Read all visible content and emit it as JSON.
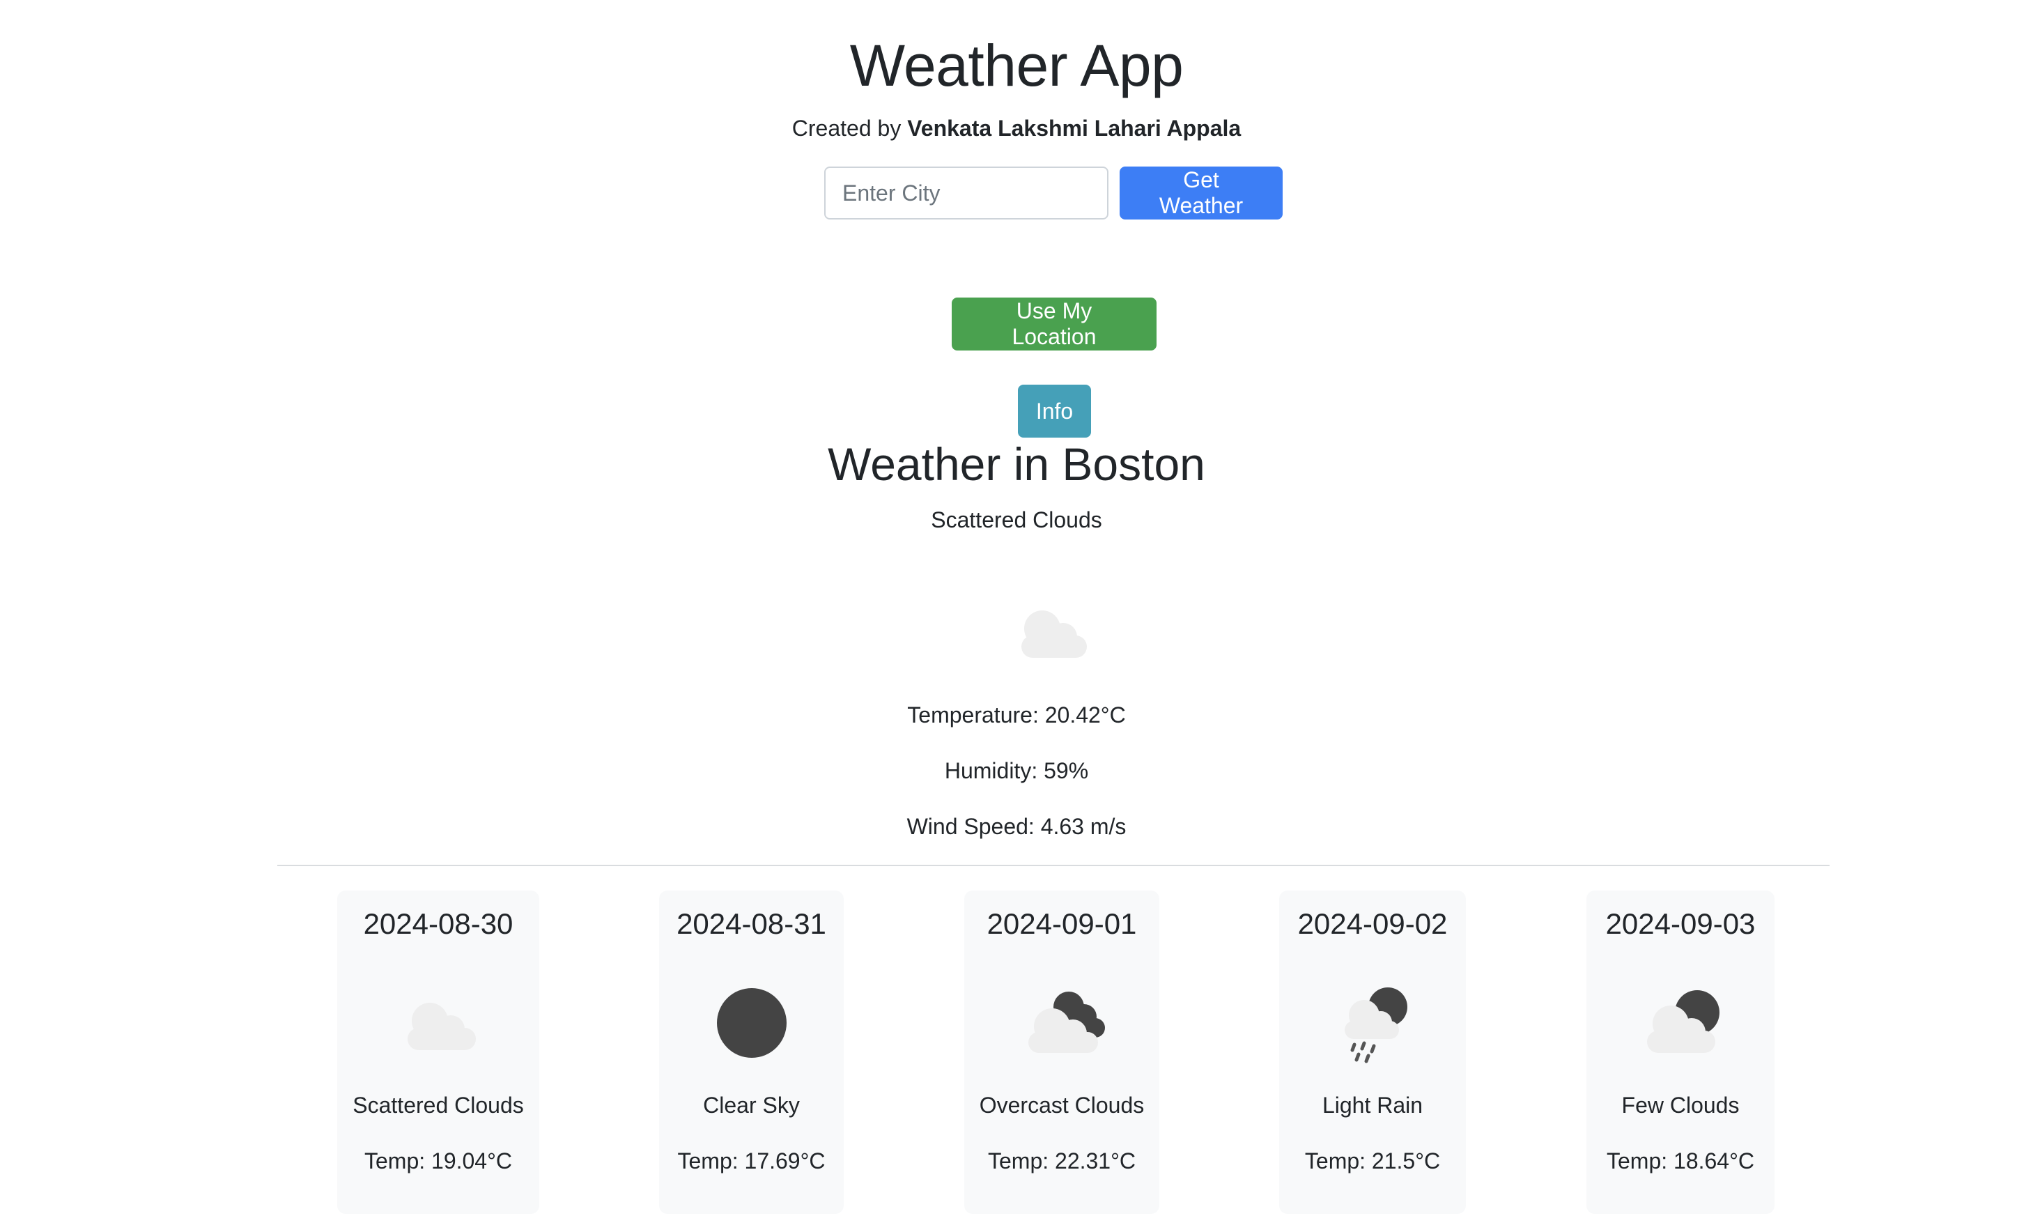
{
  "header": {
    "title": "Weather App",
    "credit_prefix": "Created by",
    "credit_name": "Venkata Lakshmi Lahari Appala"
  },
  "search": {
    "placeholder": "Enter City",
    "value": "",
    "button_label": "Get Weather"
  },
  "location_button_label": "Use My Location",
  "info_button_label": "Info",
  "current": {
    "title": "Weather in Boston",
    "description": "Scattered Clouds",
    "icon": "cloud-icon",
    "temperature": "Temperature: 20.42°C",
    "humidity": "Humidity: 59%",
    "wind_speed": "Wind Speed: 4.63 m/s"
  },
  "forecast": [
    {
      "date": "2024-08-30",
      "description": "Scattered Clouds",
      "temp": "Temp: 19.04°C",
      "icon": "cloud-icon"
    },
    {
      "date": "2024-08-31",
      "description": "Clear Sky",
      "temp": "Temp: 17.69°C",
      "icon": "clear-night-icon"
    },
    {
      "date": "2024-09-01",
      "description": "Overcast Clouds",
      "temp": "Temp: 22.31°C",
      "icon": "overcast-clouds-icon"
    },
    {
      "date": "2024-09-02",
      "description": "Light Rain",
      "temp": "Temp: 21.5°C",
      "icon": "night-rain-icon"
    },
    {
      "date": "2024-09-03",
      "description": "Few Clouds",
      "temp": "Temp: 18.64°C",
      "icon": "few-clouds-night-icon"
    }
  ],
  "colors": {
    "primary_button": "#3d7ef5",
    "success_button": "#4aa14f",
    "info_button": "#45a0b8",
    "card_background": "#f8f9fa",
    "cloud": "#eeeeee",
    "moon": "#444444"
  }
}
